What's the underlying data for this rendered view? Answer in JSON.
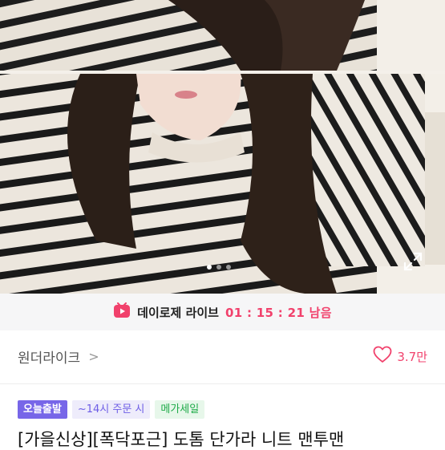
{
  "live": {
    "title": "데이로제 라이브",
    "timer": "01 : 15 : 21 남음"
  },
  "seller": {
    "name": "원더라이크",
    "chevron": ">"
  },
  "like": {
    "count": "3.7만"
  },
  "badges": {
    "today": "오늘출발",
    "order_cutoff": "~14시 주문 시",
    "mega_sale": "메가세일"
  },
  "product": {
    "title": "[가을신상][폭닥포근] 도톰 단가라 니트 맨투맨"
  },
  "colors": {
    "accent_pink": "#f1416c",
    "badge_purple": "#7766e8",
    "badge_green": "#1fab49"
  },
  "icons": {
    "live": "live-play-icon",
    "expand": "expand-icon",
    "like": "heart-outline-icon"
  },
  "gallery": {
    "current_page": 1,
    "total_pages": 3
  }
}
